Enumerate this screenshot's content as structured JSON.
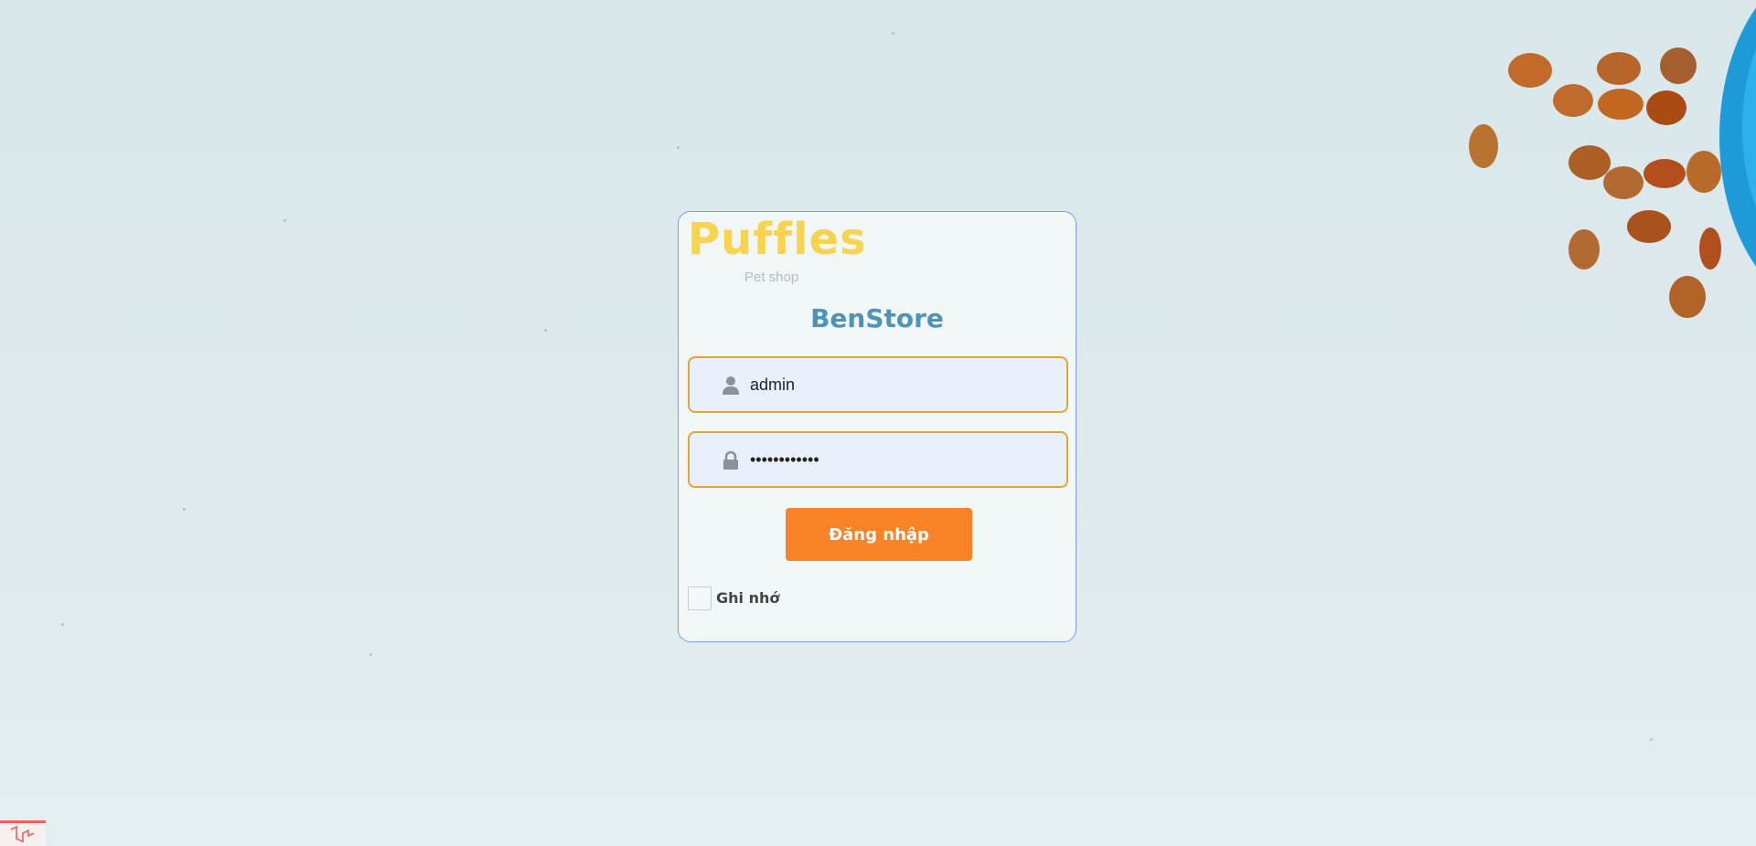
{
  "brand": {
    "name": "Puffles",
    "subtitle": "Pet shop"
  },
  "store": {
    "title": "BenStore"
  },
  "form": {
    "username": {
      "value": "admin",
      "icon": "user-icon"
    },
    "password": {
      "value": "••••••••••••",
      "icon": "lock-icon"
    },
    "submit_label": "Đăng nhập",
    "remember_label": "Ghi nhớ",
    "remember_checked": false
  },
  "colors": {
    "brand_yellow": "#f8d34d",
    "title_blue": "#4d94ba",
    "button_orange": "#f78326",
    "input_border": "#e5a533",
    "card_border": "#7f9bea"
  }
}
